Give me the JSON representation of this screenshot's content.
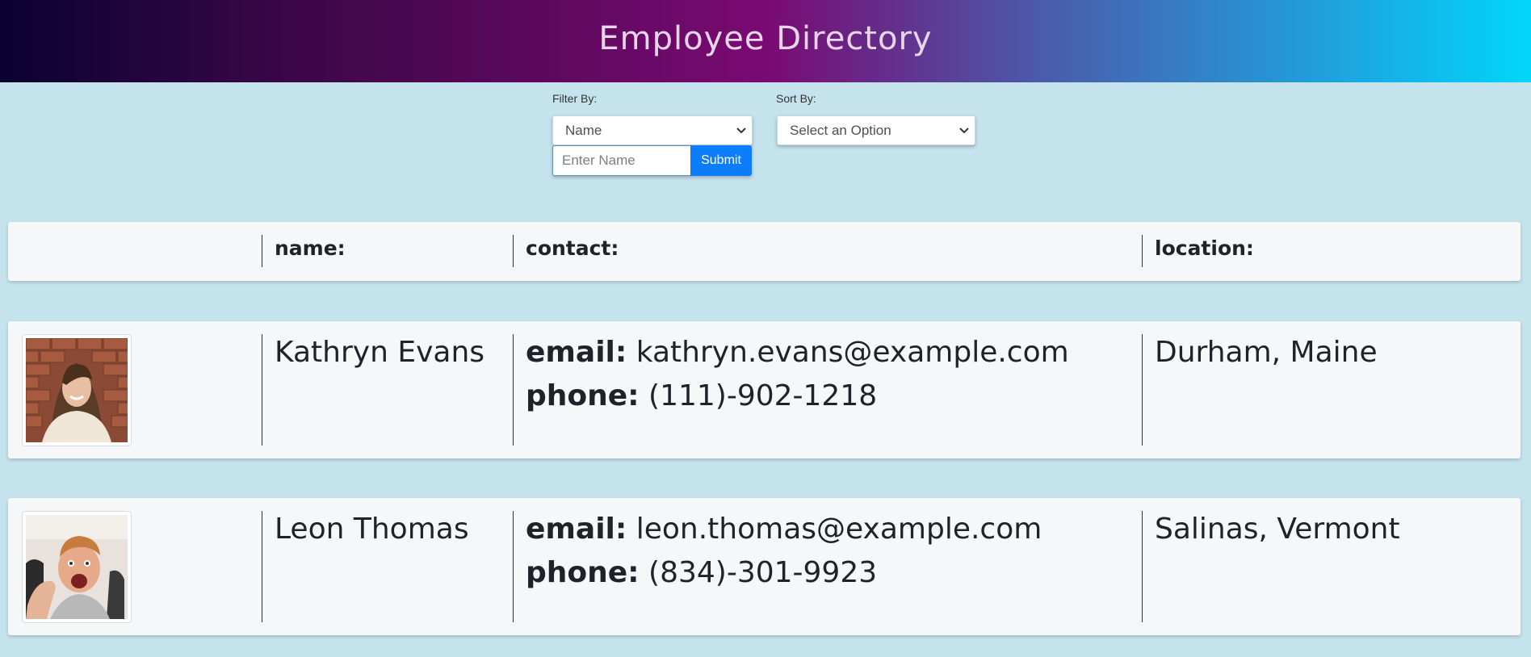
{
  "header": {
    "title": "Employee Directory"
  },
  "filters": {
    "filter_label": "Filter By:",
    "filter_value": "Name",
    "name_placeholder": "Enter Name",
    "submit_label": "Submit",
    "sort_label": "Sort By:",
    "sort_value": "Select an Option"
  },
  "table_header": {
    "name": "name:",
    "contact": "contact:",
    "location": "location:"
  },
  "employees": [
    {
      "name": "Kathryn Evans",
      "email_label": "email:",
      "email": "kathryn.evans@example.com",
      "phone_label": "phone:",
      "phone": "(111)-902-1218",
      "location": "Durham, Maine"
    },
    {
      "name": "Leon Thomas",
      "email_label": "email:",
      "email": "leon.thomas@example.com",
      "phone_label": "phone:",
      "phone": "(834)-301-9923",
      "location": "Salinas, Vermont"
    }
  ],
  "icons": {
    "select_arrow": "chevron-down-icon"
  },
  "colors": {
    "submit": "#0d7dfb",
    "background": "#c5e3ed",
    "card": "#f5f7f9"
  }
}
